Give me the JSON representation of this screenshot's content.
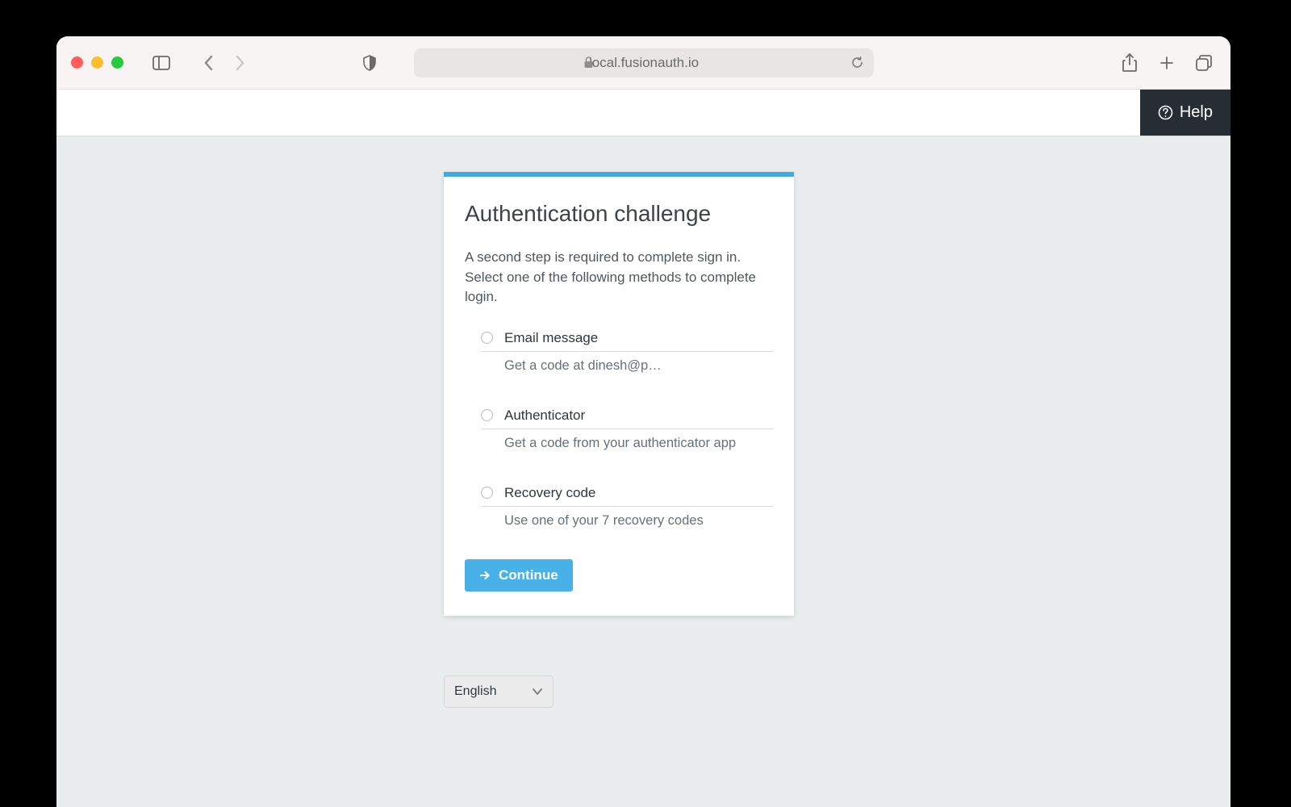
{
  "browser": {
    "url_display": "local.fusionauth.io"
  },
  "header": {
    "help_label": "Help"
  },
  "card": {
    "title": "Authentication challenge",
    "description": "A second step is required to complete sign in. Select one of the following methods to complete login.",
    "methods": [
      {
        "label": "Email message",
        "sub": "Get a code at dinesh@p…"
      },
      {
        "label": " Authenticator",
        "sub": "Get a code from your authenticator app"
      },
      {
        "label": "Recovery code",
        "sub": "Use one of your 7 recovery codes"
      }
    ],
    "continue_label": "Continue"
  },
  "language": {
    "selected": "English"
  }
}
